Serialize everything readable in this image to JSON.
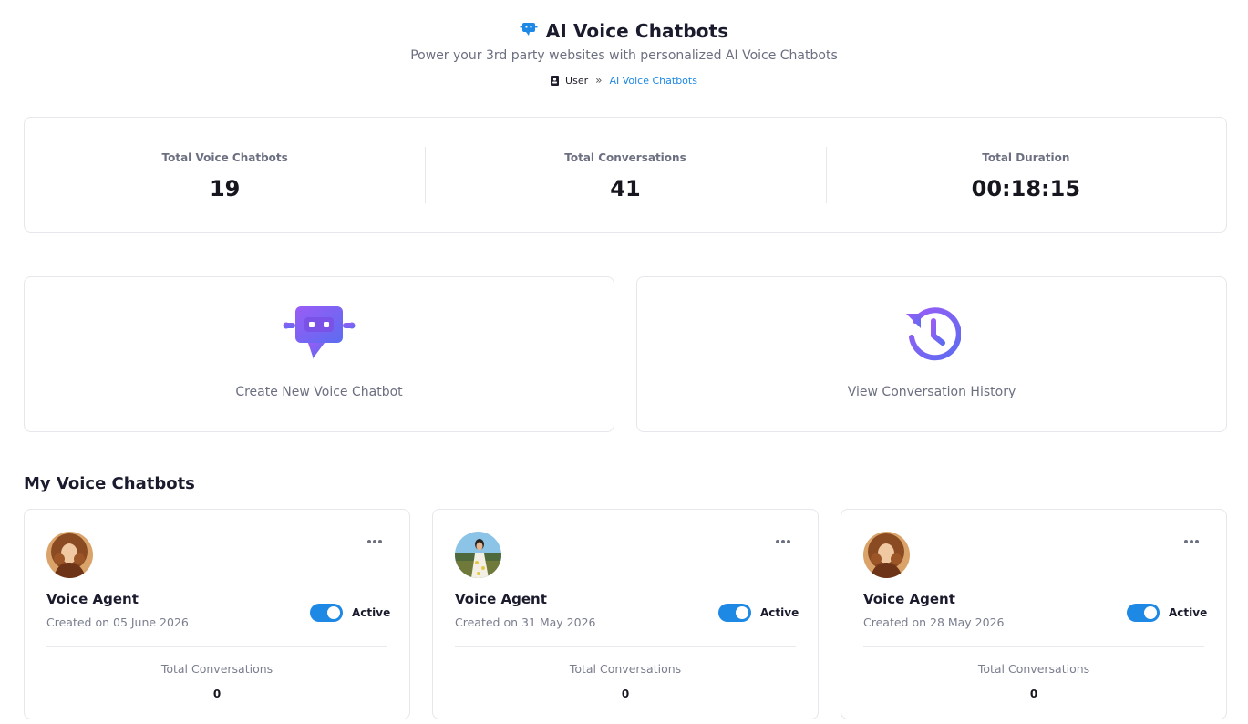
{
  "header": {
    "title": "AI Voice Chatbots",
    "subtitle": "Power your 3rd party websites with personalized AI Voice Chatbots",
    "icon": "chatbot-icon",
    "accent_color": "#1e88e5"
  },
  "breadcrumb": {
    "items": [
      "User",
      "AI Voice Chatbots"
    ],
    "separator": "»"
  },
  "stats": [
    {
      "label": "Total Voice Chatbots",
      "value": "19"
    },
    {
      "label": "Total Conversations",
      "value": "41"
    },
    {
      "label": "Total Duration",
      "value": "00:18:15"
    }
  ],
  "actions": [
    {
      "label": "Create New Voice Chatbot",
      "icon": "robot-chat-icon"
    },
    {
      "label": "View Conversation History",
      "icon": "history-icon"
    }
  ],
  "section": {
    "title": "My Voice Chatbots"
  },
  "bots": [
    {
      "name": "Voice Agent",
      "created": "Created on 05 June 2026",
      "status": "Active",
      "active": true,
      "conversations_label": "Total Conversations",
      "conversations": "0",
      "avatar": "woman-curly-hair-avatar"
    },
    {
      "name": "Voice Agent",
      "created": "Created on 31 May 2026",
      "status": "Active",
      "active": true,
      "conversations_label": "Total Conversations",
      "conversations": "0",
      "avatar": "woman-outdoor-avatar"
    },
    {
      "name": "Voice Agent",
      "created": "Created on 28 May 2026",
      "status": "Active",
      "active": true,
      "conversations_label": "Total Conversations",
      "conversations": "0",
      "avatar": "woman-curly-hair-avatar"
    }
  ],
  "colors": {
    "icon_gradient_start": "#8a5cf6",
    "icon_gradient_end": "#5b6cf0",
    "toggle_on": "#1e88e5"
  }
}
